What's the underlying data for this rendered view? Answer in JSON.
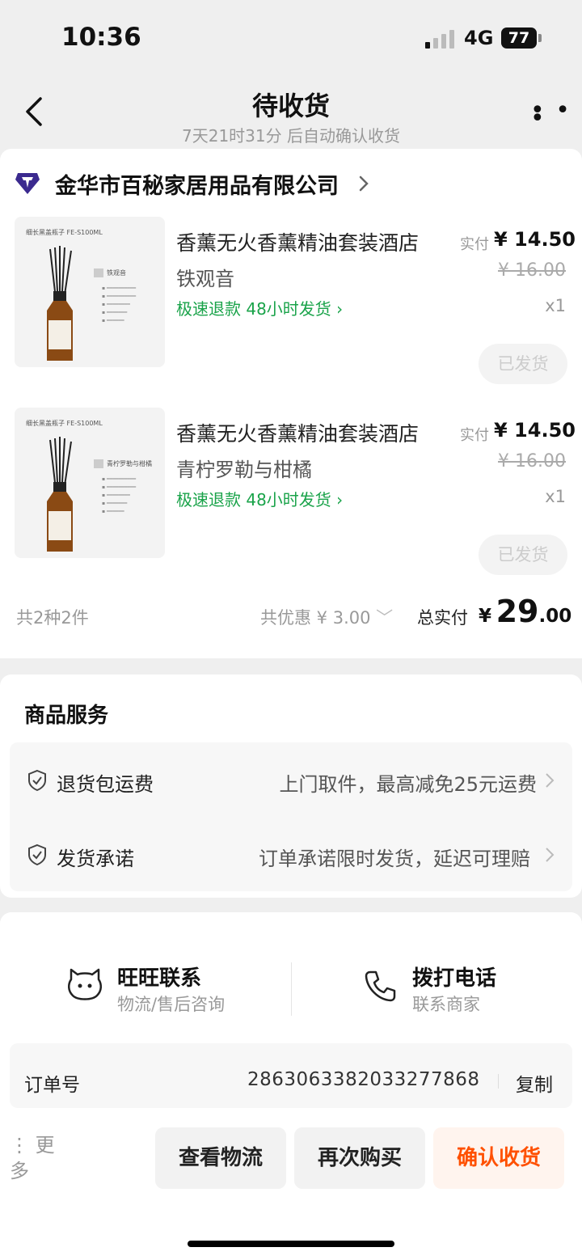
{
  "status_bar": {
    "time": "10:36",
    "network": "4G",
    "battery": "77"
  },
  "header": {
    "title": "待收货",
    "subtitle": "7天21时31分 后自动确认收货"
  },
  "shop": {
    "name": "金华市百秘家居用品有限公司"
  },
  "products": [
    {
      "thumb_label": "细长黑盖瓶子 FE-S100ML",
      "thumb_tag": "铁观音",
      "title": "香薰无火香薰精油套装酒店",
      "spec": "铁观音",
      "promo": "极速退款  48小时发货 ›",
      "paid_label": "实付",
      "paid": "¥ 14.50",
      "original": "¥ 16.00",
      "qty": "x1",
      "status_button": "已发货"
    },
    {
      "thumb_label": "细长黑盖瓶子 FE-S100ML",
      "thumb_tag": "青柠罗勒与柑橘",
      "title": "香薰无火香薰精油套装酒店",
      "spec": "青柠罗勒与柑橘",
      "promo": "极速退款  48小时发货 ›",
      "paid_label": "实付",
      "paid": "¥ 14.50",
      "original": "¥ 16.00",
      "qty": "x1",
      "status_button": "已发货"
    }
  ],
  "summary": {
    "count": "共2种2件",
    "discount": "共优惠 ¥ 3.00",
    "total_label": "总实付",
    "currency": "¥",
    "total_int": "29",
    "total_dec": ".00"
  },
  "services": {
    "title": "商品服务",
    "items": [
      {
        "name": "退货包运费",
        "desc": "上门取件，最高减免25元运费"
      },
      {
        "name": "发货承诺",
        "desc": "订单承诺限时发货，延迟可理赔"
      }
    ]
  },
  "contact": {
    "wangwang": {
      "title": "旺旺联系",
      "sub": "物流/售后咨询"
    },
    "phone": {
      "title": "拨打电话",
      "sub": "联系商家"
    }
  },
  "order": {
    "label": "订单号",
    "number": "2863063382033277868",
    "copy": "复制"
  },
  "actions": {
    "more": "更多",
    "logistics": "查看物流",
    "rebuy": "再次购买",
    "confirm": "确认收货"
  },
  "colors": {
    "accent": "#ff5000",
    "promo_green": "#1aa34a"
  }
}
